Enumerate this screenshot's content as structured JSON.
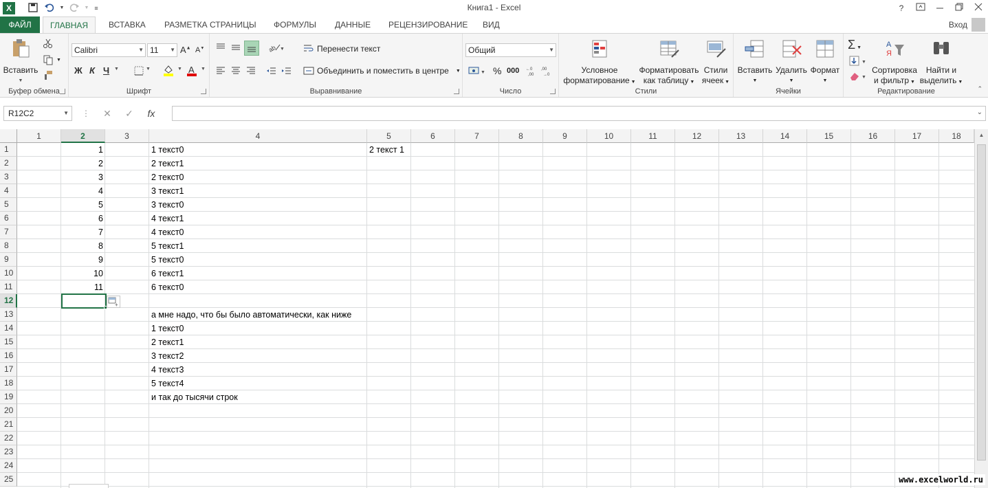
{
  "window": {
    "title": "Книга1 - Excel",
    "app_icon": "X",
    "help": "?",
    "login": "Вход"
  },
  "qat": {
    "save": "save-icon",
    "undo": "undo-icon",
    "redo": "redo-icon"
  },
  "tabs": [
    "ФАЙЛ",
    "ГЛАВНАЯ",
    "ВСТАВКА",
    "РАЗМЕТКА СТРАНИЦЫ",
    "ФОРМУЛЫ",
    "ДАННЫЕ",
    "РЕЦЕНЗИРОВАНИЕ",
    "ВИД"
  ],
  "ribbon": {
    "clipboard": {
      "label": "Буфер обмена",
      "paste": "Вставить"
    },
    "font": {
      "label": "Шрифт",
      "name": "Calibri",
      "size": "11",
      "bold": "Ж",
      "italic": "К",
      "underline": "Ч"
    },
    "alignment": {
      "label": "Выравнивание",
      "wrap": "Перенести текст",
      "merge": "Объединить и поместить в центре"
    },
    "number": {
      "label": "Число",
      "format": "Общий",
      "percent": "%",
      "thousands": "000"
    },
    "styles": {
      "label": "Стили",
      "cond_1": "Условное",
      "cond_2": "форматирование",
      "table_1": "Форматировать",
      "table_2": "как таблицу",
      "cell_1": "Стили",
      "cell_2": "ячеек"
    },
    "cells": {
      "label": "Ячейки",
      "insert": "Вставить",
      "delete": "Удалить",
      "format": "Формат"
    },
    "editing": {
      "label": "Редактирование",
      "sort_1": "Сортировка",
      "sort_2": "и фильтр",
      "find_1": "Найти и",
      "find_2": "выделить"
    }
  },
  "formula_bar": {
    "name_box": "R12C2",
    "cancel": "✕",
    "enter": "✓",
    "fx": "fx",
    "value": ""
  },
  "columns": [
    "1",
    "2",
    "3",
    "4",
    "5",
    "6",
    "7",
    "8",
    "9",
    "10",
    "11",
    "12",
    "13",
    "14",
    "15",
    "16",
    "17",
    "18"
  ],
  "rows": [
    "1",
    "2",
    "3",
    "4",
    "5",
    "6",
    "7",
    "8",
    "9",
    "10",
    "11",
    "12",
    "13",
    "14",
    "15",
    "16",
    "17",
    "18",
    "19",
    "20",
    "21",
    "22",
    "23",
    "24",
    "25"
  ],
  "cells": {
    "col2": [
      "1",
      "2",
      "3",
      "4",
      "5",
      "6",
      "7",
      "8",
      "9",
      "10",
      "11"
    ],
    "col4": [
      "1 текст0",
      "2 текст1",
      "2 текст0",
      "3 текст1",
      "3 текст0",
      "4 текст1",
      "4 текст0",
      "5 текст1",
      "5 текст0",
      "6 текст1",
      "6 текст0",
      "",
      "а мне надо, что бы было автоматически, как ниже",
      "1 текст0",
      "2 текст1",
      "3 текст2",
      "4 текст3",
      "5 текст4",
      "и так до тысячи строк"
    ],
    "r1c5": "2 текст 1"
  },
  "watermark": "www.excelworld.ru"
}
